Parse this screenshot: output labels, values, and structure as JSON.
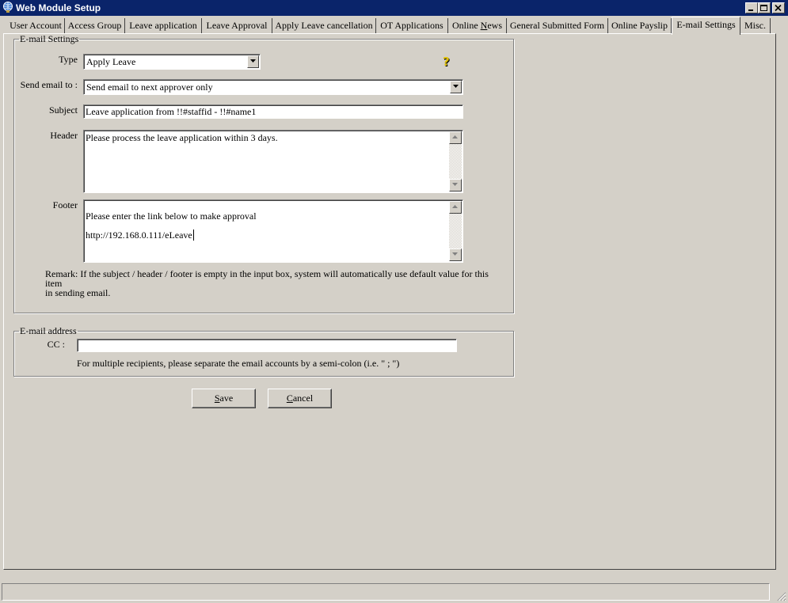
{
  "window": {
    "title": "Web Module Setup"
  },
  "tabs": [
    {
      "label": "User Account"
    },
    {
      "label": "Access Group"
    },
    {
      "label": "Leave application"
    },
    {
      "label": "Leave Approval"
    },
    {
      "label": "Apply Leave cancellation"
    },
    {
      "label": "OT Applications"
    },
    {
      "label_pre": "Online ",
      "label_ul": "N",
      "label_post": "ews"
    },
    {
      "label": "General Submitted Form"
    },
    {
      "label": "Online Payslip"
    },
    {
      "label": "E-mail Settings",
      "active": true
    },
    {
      "label": "Misc."
    }
  ],
  "email_settings": {
    "legend": "E-mail Settings",
    "type_label": "Type",
    "type_value": "Apply Leave",
    "send_to_label": "Send email to :",
    "send_to_value": "Send email to next approver only",
    "subject_label": "Subject",
    "subject_value": "Leave application from !!#staffid - !!#name1",
    "header_label": "Header",
    "header_value": "Please process the leave application within 3 days.",
    "footer_label": "Footer",
    "footer_line1": "Please enter the link below to make approval",
    "footer_line2": "http://192.168.0.111/eLeave",
    "remark_line1": "Remark: If the subject / header / footer is empty in the input box, system will automatically use default value for this item",
    "remark_line2": "in sending email."
  },
  "email_address": {
    "legend": "E-mail address",
    "cc_label": "CC :",
    "cc_value": "",
    "hint": "For multiple recipients, please separate the email accounts by a semi-colon (i.e. \" ; \")"
  },
  "buttons": {
    "save_ul": "S",
    "save_rest": "ave",
    "cancel_ul": "C",
    "cancel_rest": "ancel"
  },
  "icons": {
    "app": "globe-icon",
    "help": "question-mark-icon"
  }
}
